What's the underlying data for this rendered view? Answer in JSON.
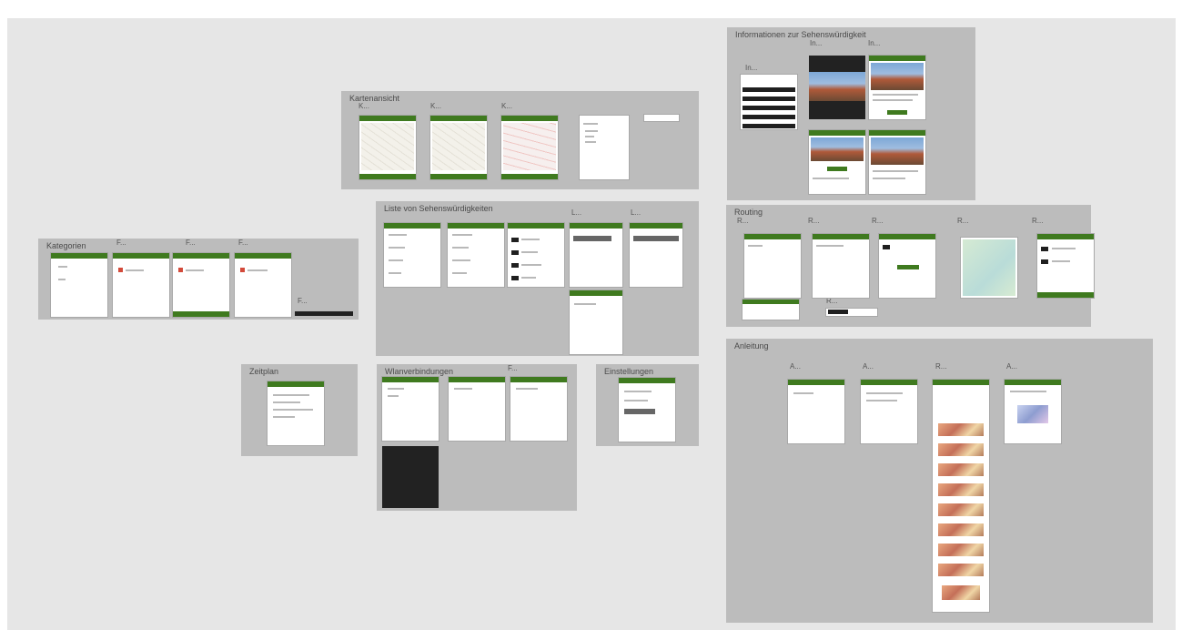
{
  "sections": {
    "s1": {
      "title": "Kartenansicht",
      "labels": [
        "K...",
        "K...",
        "K..."
      ]
    },
    "s2": {
      "title": "Liste von Sehenswürdigkeiten",
      "labels": [
        "L...",
        "L..."
      ]
    },
    "s3": {
      "title": "Kategorien",
      "labels": [
        "F...",
        "F...",
        "F...",
        "F..."
      ]
    },
    "s4": {
      "title": "Zeitplan"
    },
    "s5": {
      "title": "Wlanverbindungen",
      "labels": [
        "F..."
      ]
    },
    "s6": {
      "title": "Einstellungen"
    },
    "s7": {
      "title": "Informationen zur Sehenswürdigkeit",
      "labels": [
        "In...",
        "In...",
        "In..."
      ]
    },
    "s8": {
      "title": "Routing",
      "labels": [
        "R...",
        "R...",
        "R...",
        "R...",
        "R...",
        "R..."
      ]
    },
    "s9": {
      "title": "Anleitung",
      "labels": [
        "A...",
        "A...",
        "R...",
        "A..."
      ]
    }
  },
  "colors": {
    "canvas": "#e6e6e6",
    "section": "#bcbcbc",
    "accent": "#3f7a1f"
  }
}
